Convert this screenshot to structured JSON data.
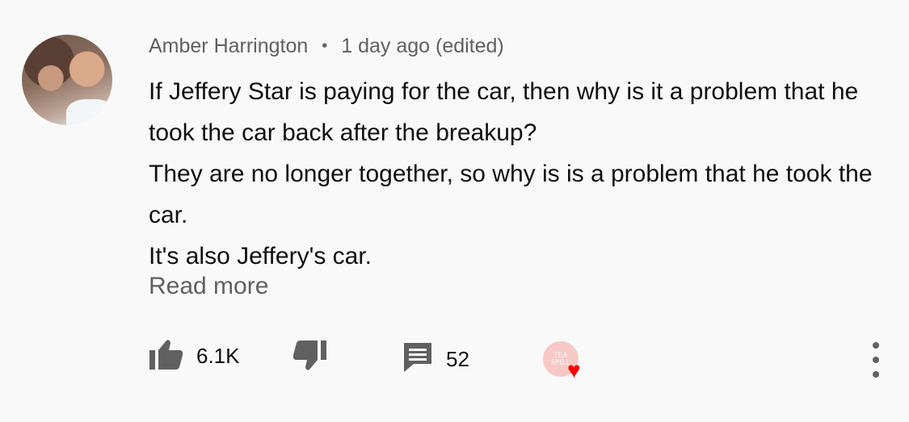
{
  "comment": {
    "author": "Amber Harrington",
    "separator": "•",
    "timestamp": "1 day ago (edited)",
    "lines": [
      "If Jeffery Star is paying for the car, then why is it a problem that he took the car back after the breakup?",
      "They are no longer together, so why is is a problem that he took the car.",
      "It's also Jeffery's car."
    ],
    "read_more": "Read more"
  },
  "actions": {
    "like_count": "6.1K",
    "reply_count": "52",
    "creator_avatar_text": [
      "TEA",
      "SPILL"
    ]
  },
  "colors": {
    "background": "#f9f9f9",
    "text": "#0f0f0f",
    "secondary": "#606060",
    "heart": "#ff0000"
  },
  "icons": [
    "thumbs-up-icon",
    "thumbs-down-icon",
    "comment-icon",
    "heart-icon",
    "more-vert-icon"
  ]
}
